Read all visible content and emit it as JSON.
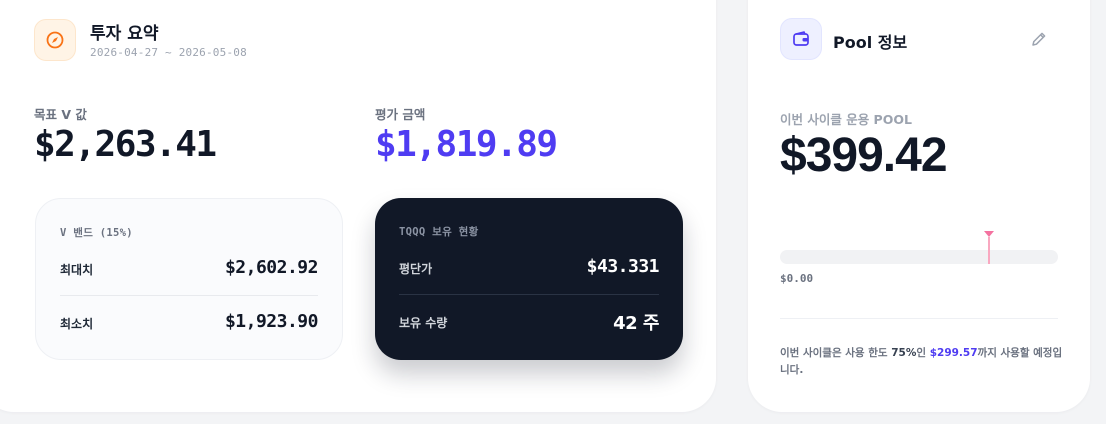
{
  "summary": {
    "title": "투자 요약",
    "date_range": "2026-04-27 ~ 2026-05-08",
    "target_v_label": "목표 V 값",
    "target_v_value": "$2,263.41",
    "eval_label": "평가 금액",
    "eval_value": "$1,819.89",
    "band": {
      "label": "V 밴드 (15%)",
      "max_label": "최대치",
      "max_value": "$2,602.92",
      "min_label": "최소치",
      "min_value": "$1,923.90"
    },
    "holding": {
      "label": "TQQQ 보유 현황",
      "avg_label": "평단가",
      "avg_value": "$43.331",
      "qty_label": "보유 수량",
      "qty_value": "42 주"
    },
    "icon": "compass-icon",
    "accent_color": "#f97316"
  },
  "pool": {
    "title": "Pool 정보",
    "cycle_label": "이번 사이클 운용 POOL",
    "cycle_value": "$399.42",
    "usage_level_fraction": 0.75,
    "track_min": "$0.00",
    "note_prefix": "이번 사이클은 사용 한도 ",
    "note_pct": "75%",
    "note_mid": "인 ",
    "note_amount": "$299.57",
    "note_suffix": "까지 사용할 예정입니다.",
    "icon": "wallet-icon",
    "edit_icon": "pencil-icon",
    "accent_color": "#4f3cf2",
    "marker_color": "#f472a0"
  }
}
